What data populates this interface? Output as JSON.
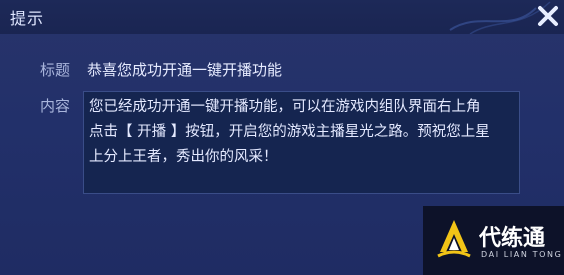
{
  "dialog": {
    "title": "提示",
    "close_icon": "close-icon"
  },
  "form": {
    "title_label": "标题",
    "title_value": "恭喜您成功开通一键开播功能",
    "content_label": "内容",
    "content_lines": [
      "您已经成功开通一键开播功能，可以在游戏内组队界面右上角",
      "点击【 开播 】按钮，开启您的游戏主播星光之路。预祝您上星",
      "上分上王者，秀出你的风采！"
    ]
  },
  "watermark": {
    "name_cn": "代练通",
    "name_en": "DAI LIAN TONG",
    "logo_icon": "dai-lian-tong-logo"
  },
  "colors": {
    "background": "#22306a",
    "title_bar": "#1d2958",
    "content_box": "#152550",
    "text": "#e4e9ff",
    "label": "#aab6dc",
    "logo_accent": "#f2c417"
  }
}
